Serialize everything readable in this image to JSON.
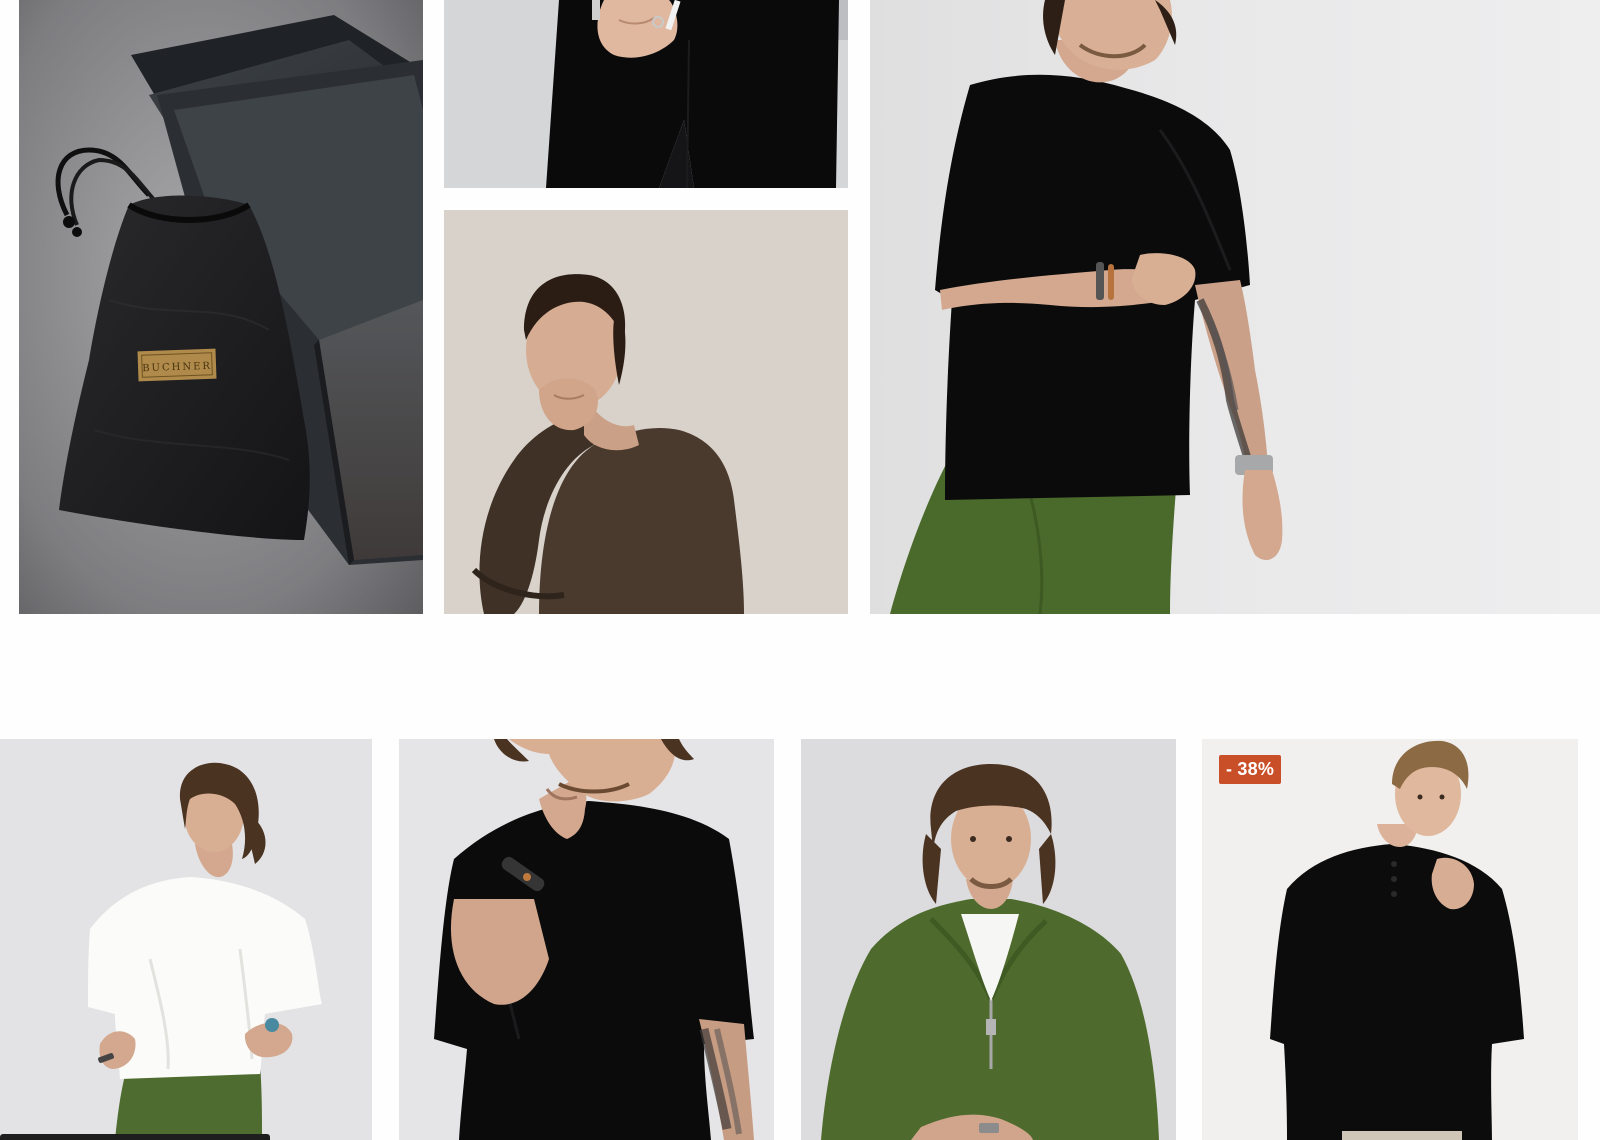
{
  "gallery": {
    "tiles": [
      {
        "name": "packaging-photo",
        "brand_label": "BUCHNER"
      },
      {
        "name": "black-pants-photo"
      },
      {
        "name": "brown-sweater-photo"
      },
      {
        "name": "black-tee-hero-photo"
      }
    ]
  },
  "products": [
    {
      "name": "white-tee-card"
    },
    {
      "name": "black-tee-card"
    },
    {
      "name": "green-zip-sweatshirt-card"
    },
    {
      "name": "black-henley-card",
      "badge": "- 38%"
    }
  ],
  "colors": {
    "badge_bg": "#c94f28",
    "background": "#fefefe"
  }
}
